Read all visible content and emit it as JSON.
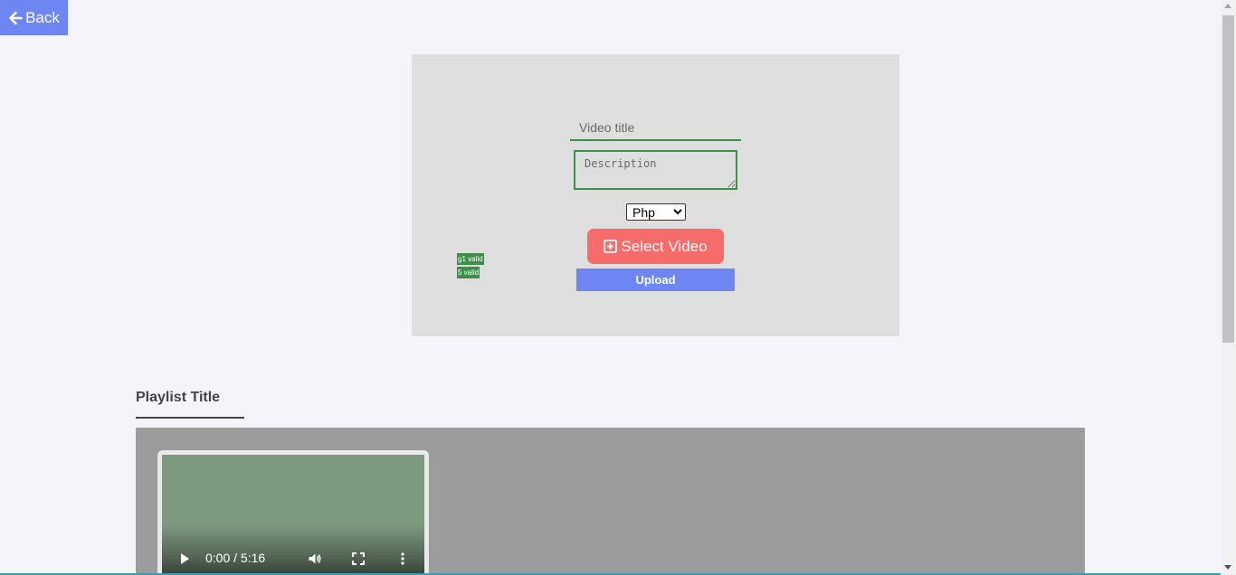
{
  "nav": {
    "back_label": "Back",
    "back_icon": "arrow-left-icon"
  },
  "upload_form": {
    "title_placeholder": "Video title",
    "title_value": "",
    "description_placeholder": "Description",
    "description_value": "",
    "category_options": [
      "Php"
    ],
    "category_selected": "Php",
    "select_video_label": "Select Video",
    "select_video_icon": "plus-square-icon",
    "upload_label": "Upload",
    "validation_badges": [
      "g1 valid",
      "5 valid"
    ]
  },
  "playlist": {
    "title": "Playlist Title",
    "videos": [
      {
        "time_display": "0:00 / 5:16"
      }
    ]
  },
  "colors": {
    "accent_blue": "#6d86f2",
    "accent_red": "#f66c6b",
    "valid_green": "#3f8f4a",
    "panel_bg": "#dedede",
    "playlist_bg": "#9c9c9c",
    "page_bg": "#f5f4f9"
  }
}
